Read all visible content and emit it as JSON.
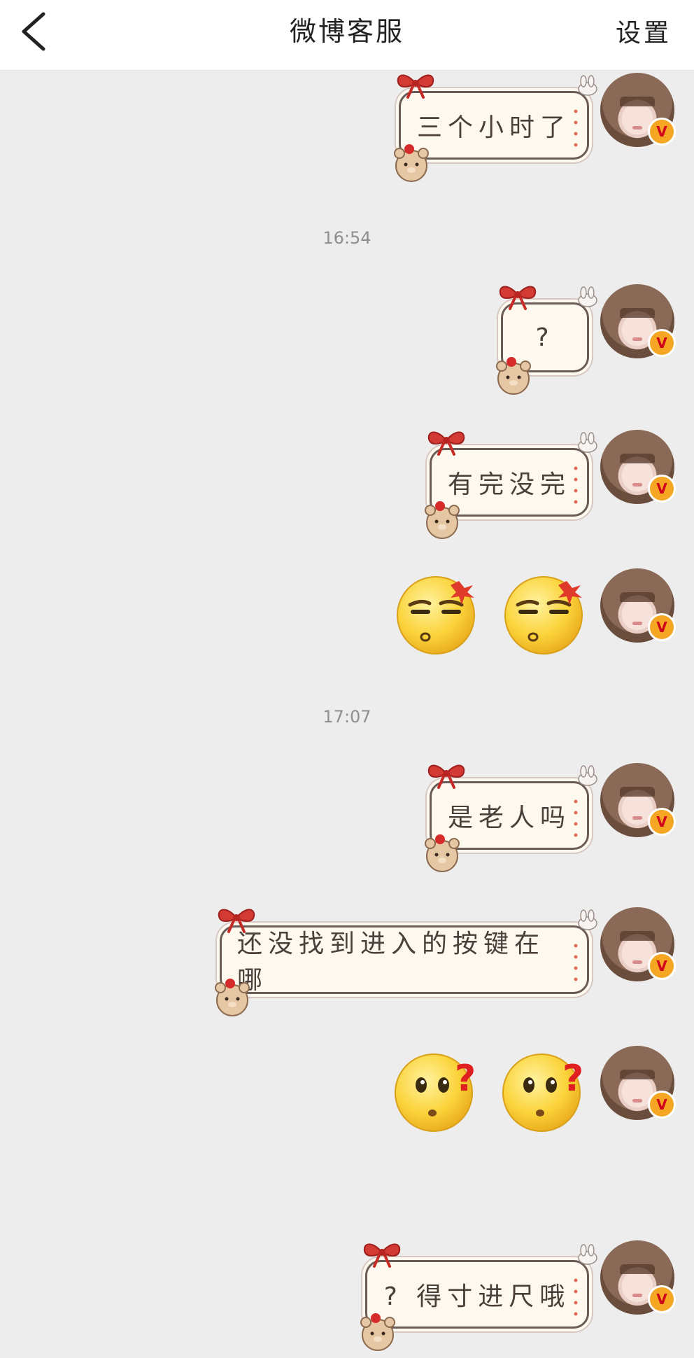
{
  "header": {
    "title": "微博客服",
    "settings_label": "设置"
  },
  "messages": [
    {
      "type": "text",
      "text": "三个小时了"
    },
    {
      "type": "timestamp",
      "text": "16:54"
    },
    {
      "type": "text",
      "text": "?"
    },
    {
      "type": "text",
      "text": "有完没完"
    },
    {
      "type": "emoji",
      "icons": [
        "annoyed-face-icon",
        "annoyed-face-icon"
      ]
    },
    {
      "type": "timestamp",
      "text": "17:07"
    },
    {
      "type": "text",
      "text": "是老人吗"
    },
    {
      "type": "text",
      "text": "还没找到进入的按键在哪"
    },
    {
      "type": "emoji",
      "icons": [
        "confused-face-icon",
        "confused-face-icon"
      ]
    },
    {
      "type": "text",
      "text": "? 得寸进尺哦"
    }
  ],
  "avatar_badge": "V",
  "colors": {
    "background": "#ededed",
    "header": "#ffffff",
    "bubble": "#fdf9ee",
    "badge": "#f5a623"
  }
}
